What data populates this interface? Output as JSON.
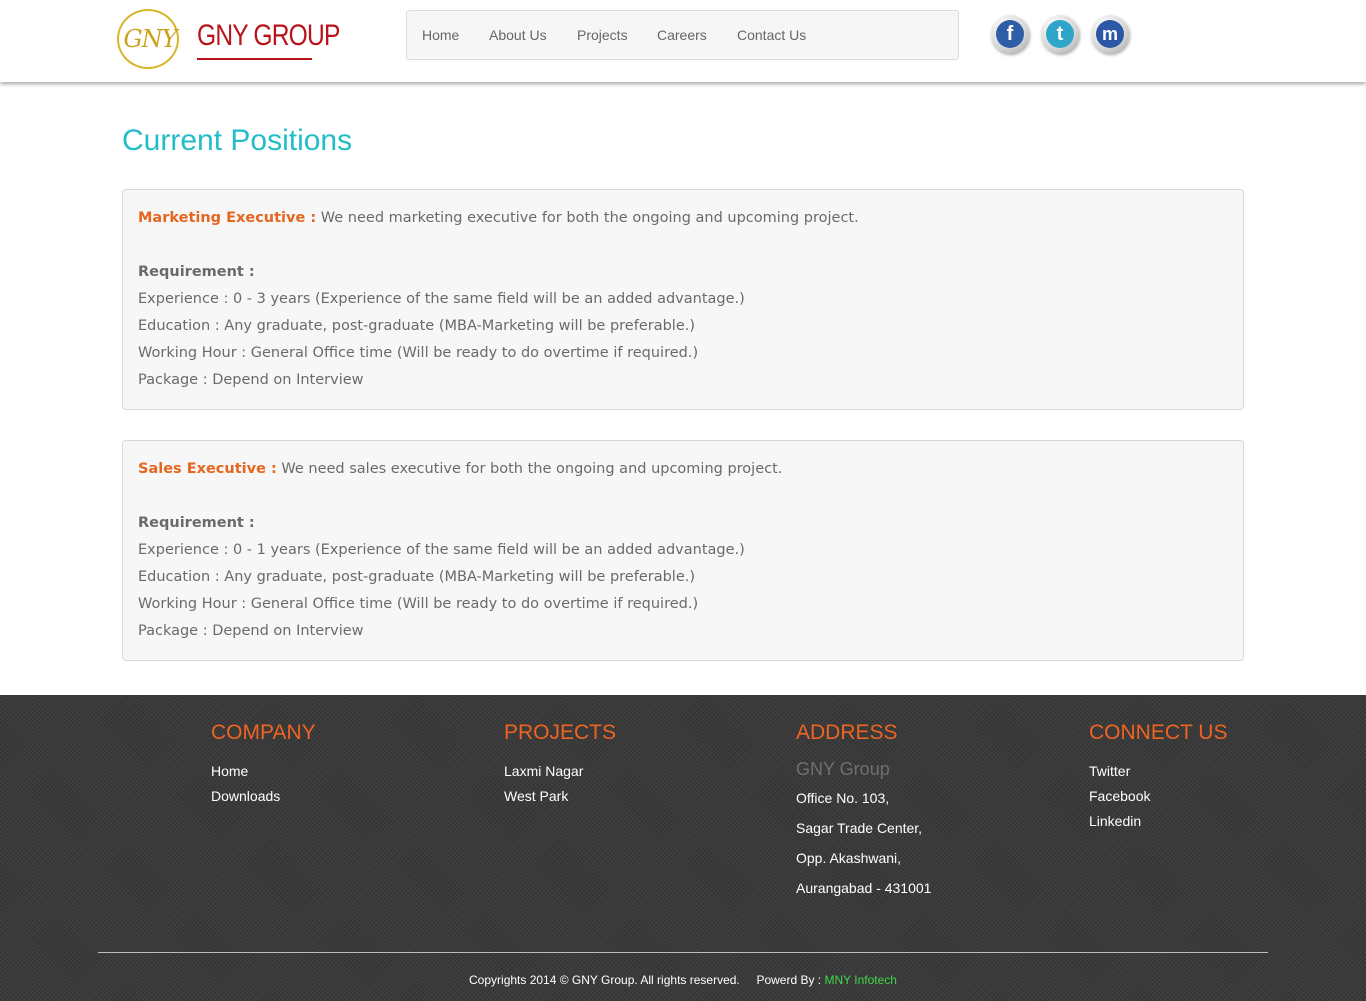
{
  "header": {
    "logo_mark": "GNY",
    "logo_word": "GNY GROUP",
    "nav": [
      "Home",
      "About Us",
      "Projects",
      "Careers",
      "Contact Us"
    ],
    "social": [
      {
        "icon": "facebook-icon",
        "glyph": "f",
        "color": "#2f5ea8"
      },
      {
        "icon": "twitter-icon",
        "glyph": "t",
        "color": "#2fa6c9"
      },
      {
        "icon": "myspace-icon",
        "glyph": "m",
        "color": "#2c56a6"
      }
    ]
  },
  "main": {
    "title": "Current Positions",
    "jobs": [
      {
        "title": "Marketing Executive :",
        "summary": " We need marketing executive for both the ongoing and upcoming project.",
        "requirement_label": "Requirement :",
        "experience": "Experience : 0 - 3 years (Experience of the same field will be an added advantage.)",
        "education": "Education : Any graduate, post-graduate (MBA-Marketing will be preferable.)",
        "working_hour": "Working Hour : General Office time (Will be ready to do overtime if required.)",
        "package": "Package : Depend on Interview"
      },
      {
        "title": "Sales Executive :",
        "summary": " We need sales executive for both the ongoing and upcoming project.",
        "requirement_label": "Requirement :",
        "experience": "Experience : 0 - 1 years (Experience of the same field will be an added advantage.)",
        "education": "Education : Any graduate, post-graduate (MBA-Marketing will be preferable.)",
        "working_hour": "Working Hour : General Office time (Will be ready to do overtime if required.)",
        "package": "Package : Depend on Interview"
      }
    ]
  },
  "footer": {
    "company": {
      "heading": "COMPANY",
      "links": [
        "Home",
        "Downloads"
      ]
    },
    "projects": {
      "heading": "PROJECTS",
      "links": [
        "Laxmi Nagar",
        "West Park"
      ]
    },
    "address": {
      "heading": "ADDRESS",
      "company_name": "GNY Group",
      "lines": [
        "Office No. 103,",
        "Sagar Trade Center,",
        "Opp. Akashwani,",
        "Aurangabad - 431001"
      ]
    },
    "connect": {
      "heading": "CONNECT US",
      "links": [
        "Twitter",
        "Facebook",
        "Linkedin"
      ]
    },
    "copyright": "Copyrights 2014 © GNY Group. All rights reserved.",
    "powered_by_label": "Powerd By :",
    "powered_by_name": "MNY Infotech"
  }
}
